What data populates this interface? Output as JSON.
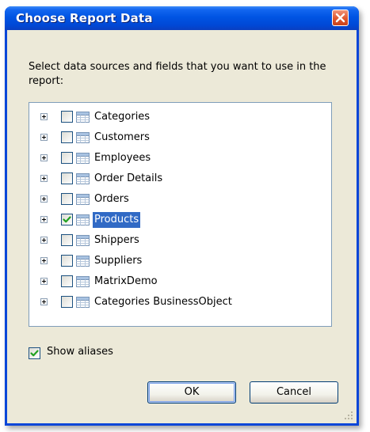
{
  "window": {
    "title": "Choose Report Data",
    "close_icon": "close-icon"
  },
  "instructions": "Select data sources and fields that you want to use in the report:",
  "tree": {
    "items": [
      {
        "label": "Categories",
        "checked": false,
        "selected": false
      },
      {
        "label": "Customers",
        "checked": false,
        "selected": false
      },
      {
        "label": "Employees",
        "checked": false,
        "selected": false
      },
      {
        "label": "Order Details",
        "checked": false,
        "selected": false
      },
      {
        "label": "Orders",
        "checked": false,
        "selected": false
      },
      {
        "label": "Products",
        "checked": true,
        "selected": true
      },
      {
        "label": "Shippers",
        "checked": false,
        "selected": false
      },
      {
        "label": "Suppliers",
        "checked": false,
        "selected": false
      },
      {
        "label": "MatrixDemo",
        "checked": false,
        "selected": false
      },
      {
        "label": "Categories BusinessObject",
        "checked": false,
        "selected": false
      }
    ]
  },
  "show_aliases": {
    "label": "Show aliases",
    "checked": true
  },
  "buttons": {
    "ok": "OK",
    "cancel": "Cancel"
  },
  "colors": {
    "title_bar": "#0054e3",
    "dialog_face": "#ece9d8",
    "selection": "#316ac5",
    "check_mark": "#21a121",
    "close_button": "#e0572e"
  }
}
